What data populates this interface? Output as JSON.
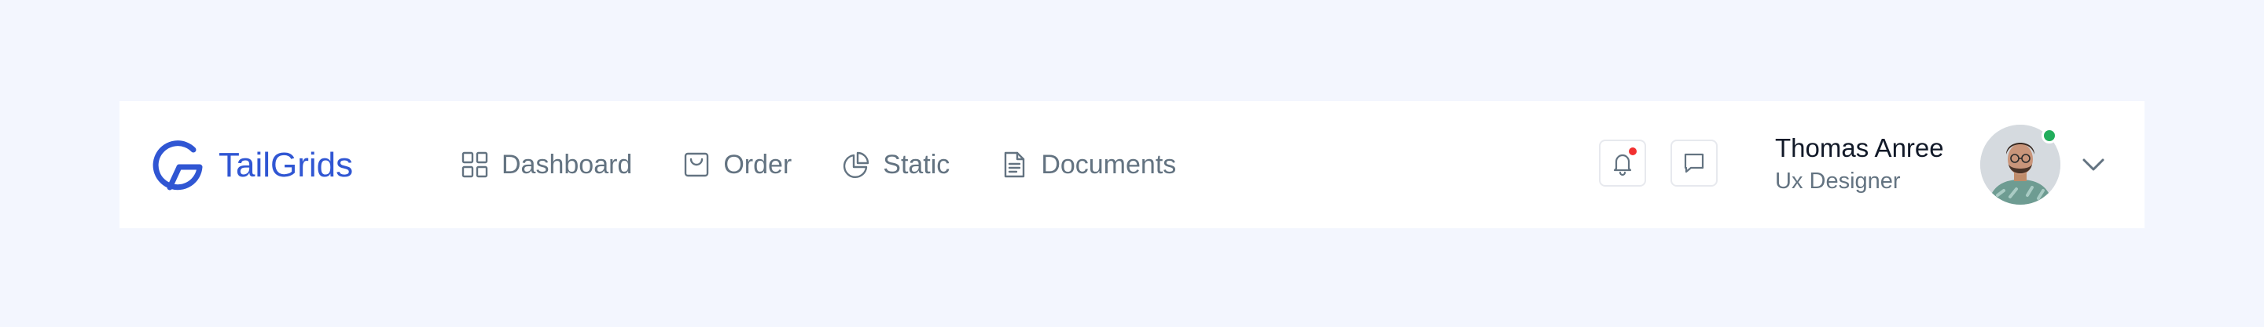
{
  "brand": {
    "name": "TailGrids",
    "color": "#3056D3"
  },
  "nav": {
    "items": [
      {
        "label": "Dashboard",
        "icon": "grid-icon"
      },
      {
        "label": "Order",
        "icon": "shopping-bag-icon"
      },
      {
        "label": "Static",
        "icon": "pie-chart-icon"
      },
      {
        "label": "Documents",
        "icon": "document-icon"
      }
    ]
  },
  "actions": {
    "notification_icon": "bell-icon",
    "notification_dot_color": "#F23030",
    "message_icon": "message-icon"
  },
  "user": {
    "name": "Thomas Anree",
    "role": "Ux Designer",
    "status_color": "#22AD5C",
    "menu_icon": "chevron-down-icon"
  }
}
